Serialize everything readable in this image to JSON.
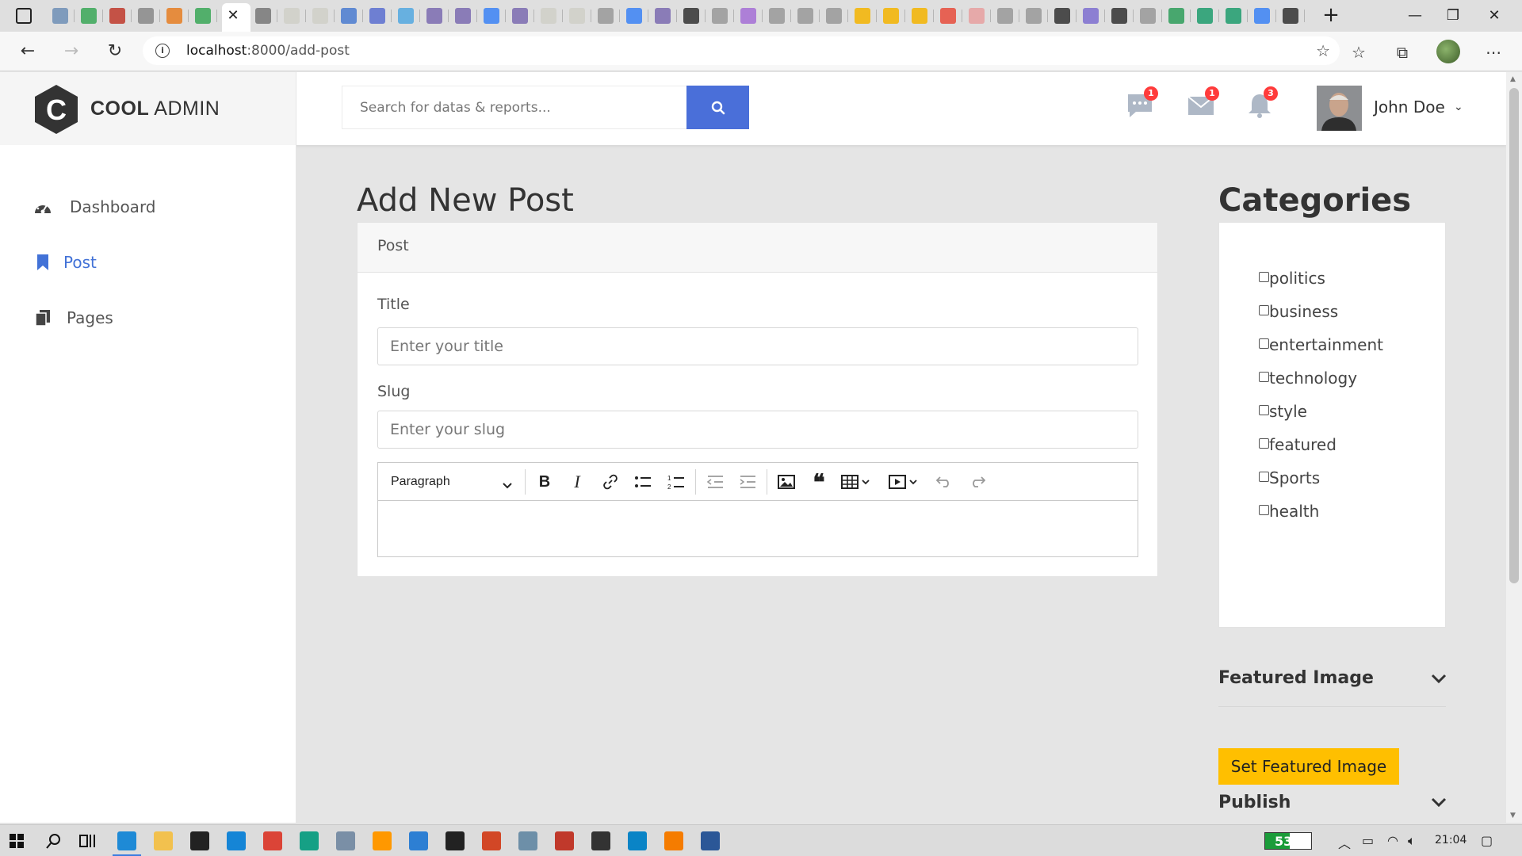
{
  "browser": {
    "url_host": "localhost",
    "url_path": ":8000/add-post",
    "tab_icon_colors": [
      "#6e8fb6",
      "#3aa757",
      "#c0392b",
      "#888888",
      "#e67e22",
      "#3aa757",
      "#777777",
      "#d0d0c8",
      "#d0d0c8",
      "#4a7bd0",
      "#5a6fd0",
      "#52a8e0",
      "#7b6bb0",
      "#7b6bb0",
      "#3b82f6",
      "#7b6bb0",
      "#d0d0c8",
      "#d0d0c8",
      "#999999",
      "#3b82f6",
      "#7b6bb0",
      "#333333",
      "#999999",
      "#a56ed6",
      "#999999",
      "#999999",
      "#999999",
      "#f4b400",
      "#f4b400",
      "#f4b400",
      "#e74c3c",
      "#e8a0a0",
      "#999999",
      "#999999",
      "#333333",
      "#7e6fd0",
      "#333333",
      "#999999",
      "#2e9d5a",
      "#1f9c6d",
      "#1f9c6d",
      "#3b82f6",
      "#333333"
    ]
  },
  "app": {
    "logo_bold": "COOL",
    "logo_light": " ADMIN",
    "logo_letter": "C",
    "search_placeholder": "Search for datas & reports...",
    "notifications": {
      "messages": "1",
      "emails": "1",
      "alerts": "3"
    },
    "user_name": "John Doe"
  },
  "sidebar": {
    "items": [
      {
        "label": "Dashboard",
        "icon": "dashboard-icon",
        "active": false
      },
      {
        "label": "Post",
        "icon": "bookmark-icon",
        "active": true
      },
      {
        "label": "Pages",
        "icon": "copy-icon",
        "active": false
      }
    ]
  },
  "main": {
    "page_title": "Add New Post",
    "card_header": "Post",
    "title_label": "Title",
    "title_placeholder": "Enter your title",
    "slug_label": "Slug",
    "slug_placeholder": "Enter your slug",
    "editor_heading": "Paragraph"
  },
  "categories": {
    "title": "Categories",
    "items": [
      "politics",
      "business",
      "entertainment",
      "technology",
      "style",
      "featured",
      "Sports",
      "health"
    ]
  },
  "featured_image": {
    "title": "Featured Image",
    "button": "Set Featured Image"
  },
  "publish": {
    "title": "Publish"
  },
  "taskbar": {
    "battery": "53%",
    "time": "21:04",
    "accent": "#3b7de0"
  }
}
